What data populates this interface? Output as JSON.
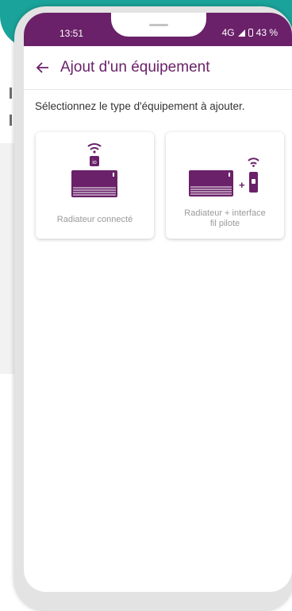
{
  "status_bar": {
    "time": "13:51",
    "network": "4G",
    "battery": "43 %"
  },
  "app_bar": {
    "title": "Ajout d'un équipement"
  },
  "prompt": "Sélectionnez le type d'équipement à ajouter.",
  "cards": [
    {
      "label": "Radiateur connecté"
    },
    {
      "label_line1": "Radiateur + interface",
      "label_line2": "fil pilote",
      "plus": "+"
    }
  ],
  "colors": {
    "primary": "#6a2169",
    "teal": "#1aa39a"
  }
}
